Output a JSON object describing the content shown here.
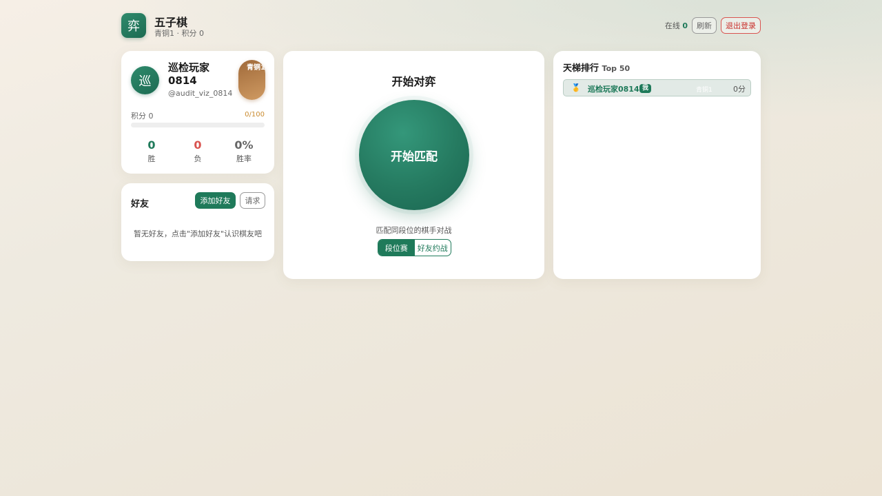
{
  "header": {
    "logo_char": "弈",
    "title": "五子棋",
    "subtitle": "青铜1 · 积分 0",
    "online_label": "在线",
    "online_count": "0",
    "refresh_label": "刷新",
    "logout_label": "退出登录"
  },
  "profile": {
    "avatar_char": "巡",
    "name": "巡检玩家0814",
    "handle": "@audit_viz_0814",
    "rank_badge": "青铜1",
    "points_label": "积分 0",
    "points_progress_text": "0/100",
    "progress_fraction": 0,
    "wins": "0",
    "wins_label": "胜",
    "losses": "0",
    "losses_label": "负",
    "win_rate": "0%",
    "win_rate_label": "胜率"
  },
  "friends": {
    "title": "好友",
    "add_label": "添加好友",
    "requests_label": "请求",
    "empty_text": "暂无好友，点击\"添加好友\"认识棋友吧"
  },
  "match": {
    "title": "开始对弈",
    "start_label": "开始匹配",
    "description": "匹配同段位的棋手对战",
    "modes": [
      "段位赛",
      "好友约战"
    ],
    "active_mode": 0
  },
  "ladder": {
    "title": "天梯排行",
    "subtitle": "Top 50",
    "rows": [
      {
        "medal": "🥇",
        "name": "巡检玩家0814",
        "me_tag": "我",
        "rank": "青铜1",
        "score": "0分"
      }
    ]
  },
  "colors": {
    "brand_green": "#1f7a5a",
    "loss_red": "#d9534f",
    "bronze": "#a06a3a"
  }
}
